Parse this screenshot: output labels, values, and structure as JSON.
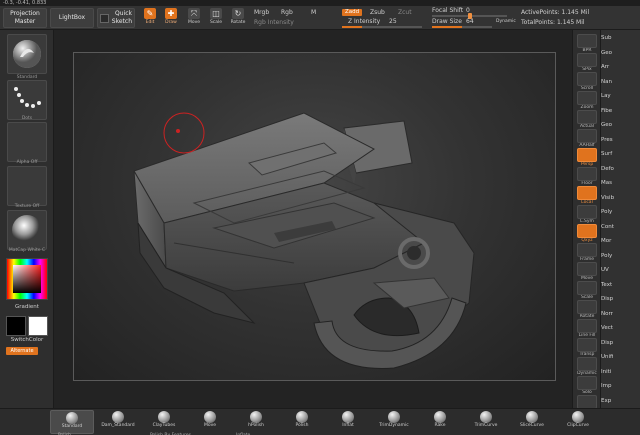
{
  "header": {
    "coords_text": "-0.3, -0.41, 0.833"
  },
  "toolbar": {
    "projection_master": "Projection Master",
    "lightbox": "LightBox",
    "quick_sketch": "Quick Sketch",
    "edit": "Edit",
    "draw": "Draw",
    "move": "Move",
    "scale": "Scale",
    "rotate": "Rotate",
    "mrgb": "Mrgb",
    "rgb": "Rgb",
    "m": "M",
    "rgb_intensity": "Rgb Intensity",
    "zadd": "Zadd",
    "zsub": "Zsub",
    "zcut": "Zcut",
    "z_intensity_label": "Z Intensity",
    "z_intensity_value": "25",
    "z_intensity_fraction": 0.25,
    "focal_shift_label": "Focal Shift",
    "focal_shift_value": "0",
    "focal_shift_fraction": 0.5,
    "draw_size_label": "Draw Size",
    "draw_size_value": "64",
    "draw_size_fraction": 0.5,
    "dynamic": "Dynamic",
    "active_points": "ActivePoints: 1.145 Mil",
    "total_points": "TotalPoints: 1.145 Mil"
  },
  "left_shelf": {
    "standard": "Standard",
    "dots": "Dots",
    "alpha_off": "Alpha Off",
    "texture_off": "Texture Off",
    "matcap": "MatCap White C",
    "gradient": "Gradient",
    "switch_color": "SwitchColor",
    "alternate": "Alternate"
  },
  "right_shelf": {
    "items": [
      {
        "label": "BPR",
        "orange": false
      },
      {
        "label": "SPix",
        "orange": false
      },
      {
        "label": "Scroll",
        "orange": false
      },
      {
        "label": "Zoom",
        "orange": false
      },
      {
        "label": "Actual",
        "orange": false
      },
      {
        "label": "AAHalf",
        "orange": false
      },
      {
        "label": "Persp",
        "orange": true
      },
      {
        "label": "Floor",
        "orange": false
      },
      {
        "label": "Local",
        "orange": true
      },
      {
        "label": "L.Sym",
        "orange": false
      },
      {
        "label": "Qxyz",
        "orange": true
      },
      {
        "label": "Frame",
        "orange": false
      },
      {
        "label": "Move",
        "orange": false
      },
      {
        "label": "Scale",
        "orange": false
      },
      {
        "label": "Rotate",
        "orange": false
      },
      {
        "label": "Line Fill",
        "orange": false
      },
      {
        "label": "Transp",
        "orange": false
      },
      {
        "label": "Dynamic",
        "orange": false
      },
      {
        "label": "Solo",
        "orange": false
      },
      {
        "label": "Xpose",
        "orange": false
      }
    ]
  },
  "right_tray": {
    "items": [
      "Sub",
      "Geo",
      "Arr",
      "Nan",
      "Lay",
      "Fibe",
      "Geo",
      "Pres",
      "Surf",
      "Defo",
      "Mas",
      "Visib",
      "Poly",
      "Cont",
      "Mor",
      "Poly",
      "UV",
      "Text",
      "Disp",
      "Norr",
      "Vect",
      "Disp",
      "Unifi",
      "Initi",
      "Imp",
      "Exp"
    ]
  },
  "bottom_shelf": {
    "brushes": [
      "Standard",
      "Dam_Standard",
      "ClayTubes",
      "Move",
      "hPolish",
      "Polish",
      "Inflat",
      "TrimDynamic",
      "Rake",
      "TrimCurve",
      "SliceCurve",
      "ClipCurve"
    ],
    "row2": [
      "Polish",
      "Polish By Features",
      "Inflate"
    ]
  },
  "colors": {
    "accent": "#e0731e",
    "canvas_bg": "#333333",
    "model": "#5a5a5a"
  }
}
